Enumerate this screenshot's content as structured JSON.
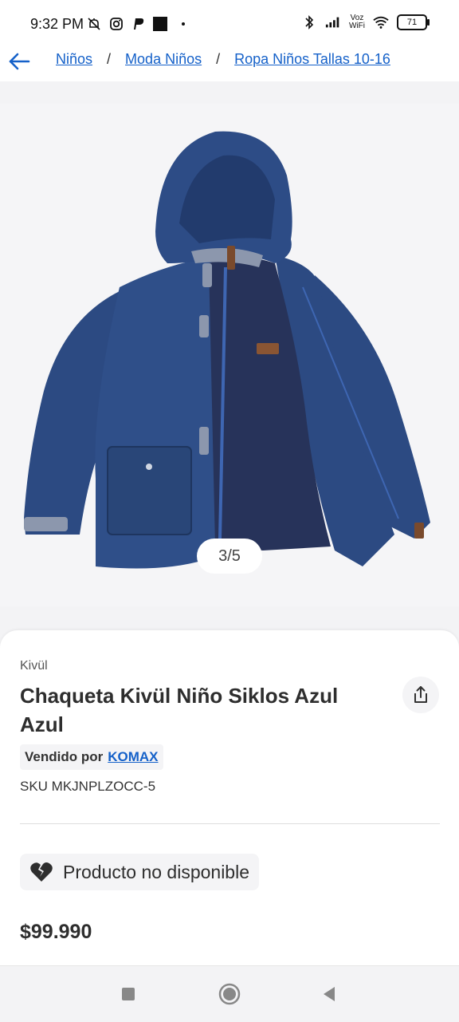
{
  "status_bar": {
    "time": "9:32 PM",
    "voz_label": "Voz",
    "wifi_label": "WiFi",
    "battery": "71"
  },
  "breadcrumb": {
    "items": [
      "Niños",
      "Moda Niños",
      "Ropa Niños Tallas 10-16"
    ],
    "separator": "/"
  },
  "gallery": {
    "counter": "3/5"
  },
  "product": {
    "brand": "Kivül",
    "title": "Chaqueta Kivül Niño Siklos Azul Azul",
    "sold_by_label": "Vendido por",
    "seller": "KOMAX",
    "sku": "SKU MKJNPLZOCC-5",
    "availability": "Producto no disponible",
    "price": "$99.990"
  },
  "colors": {
    "link": "#1561c9",
    "jacket": "#2c4a82",
    "fleece": "#27335a"
  },
  "icons": {
    "back": "arrow-left-icon",
    "share": "share-icon",
    "availability": "broken-heart-icon",
    "nav": [
      "recents-square-icon",
      "home-circle-icon",
      "back-triangle-icon"
    ]
  }
}
